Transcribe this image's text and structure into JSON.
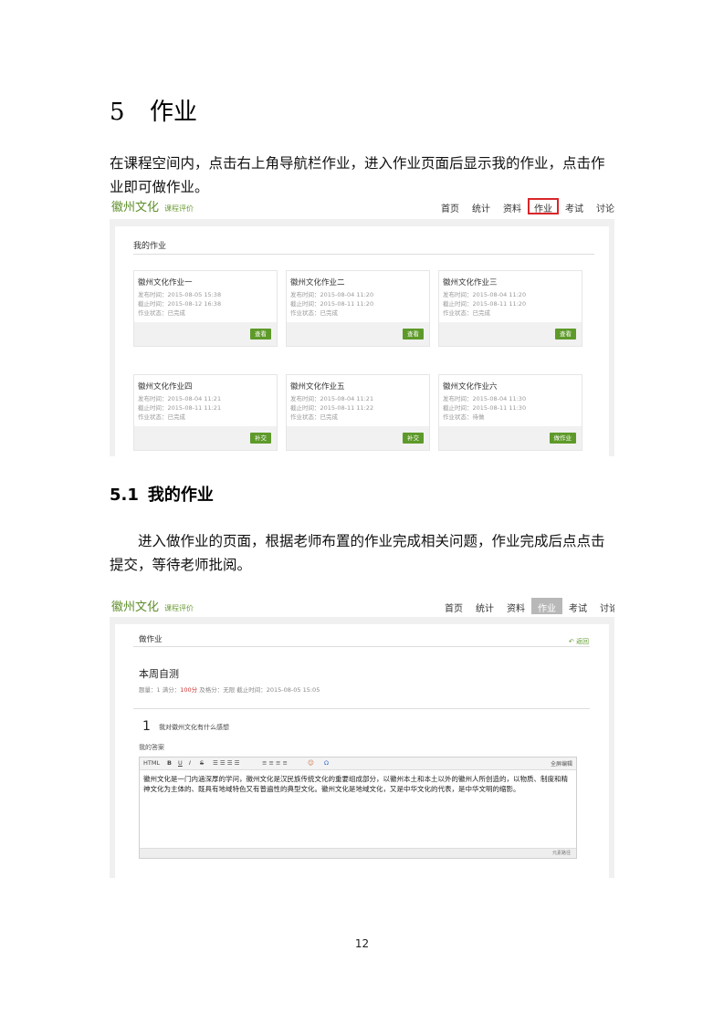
{
  "heading": {
    "num": "5",
    "title": "作业"
  },
  "intro": "在课程空间内，点击右上角导航栏作业，进入作业页面后显示我的作业，点击作业即可做作业。",
  "shot1": {
    "brand": "徽州文化",
    "brand_sub": "课程评价",
    "nav": [
      "首页",
      "统计",
      "资料",
      "作业",
      "考试",
      "讨论"
    ],
    "section_title": "我的作业",
    "cards": [
      {
        "title": "徽州文化作业一",
        "lines": [
          "发布时间：2015-08-05 15:38",
          "截止时间：2015-08-12 16:38",
          "作业状态：已完成"
        ],
        "button": "查看"
      },
      {
        "title": "徽州文化作业二",
        "lines": [
          "发布时间：2015-08-04 11:20",
          "截止时间：2015-08-11 11:20",
          "作业状态：已完成"
        ],
        "button": "查看"
      },
      {
        "title": "徽州文化作业三",
        "lines": [
          "发布时间：2015-08-04 11:20",
          "截止时间：2015-08-11 11:20",
          "作业状态：已完成"
        ],
        "button": "查看"
      },
      {
        "title": "徽州文化作业四",
        "lines": [
          "发布时间：2015-08-04 11:21",
          "截止时间：2015-08-11 11:21",
          "作业状态：已完成"
        ],
        "button": "补交"
      },
      {
        "title": "徽州文化作业五",
        "lines": [
          "发布时间：2015-08-04 11:21",
          "截止时间：2015-08-11 11:22",
          "作业状态：已完成"
        ],
        "button": "补交"
      },
      {
        "title": "徽州文化作业六",
        "lines": [
          "发布时间：2015-08-04 11:30",
          "截止时间：2015-08-11 11:30",
          "作业状态：待做"
        ],
        "button": "做作业"
      }
    ]
  },
  "section": {
    "num": "5.1",
    "title": "我的作业"
  },
  "body": "进入做作业的页面，根据老师布置的作业完成相关问题，作业完成后点点击提交，等待老师批阅。",
  "shot2": {
    "brand": "徽州文化",
    "brand_sub": "课程评价",
    "nav": [
      "首页",
      "统计",
      "资料",
      "作业",
      "考试",
      "讨论"
    ],
    "panel_title": "做作业",
    "back": "返回",
    "quiz_title": "本周自测",
    "meta_pre": "题量：1 满分：",
    "meta_red": "100分",
    "meta_post": " 及格分：无限 截止时间：2015-08-05 15:05",
    "q_no": "1",
    "q_text": "我对徽州文化有什么感想",
    "answer_label": "我的答案",
    "toolbar_items": [
      "HTML",
      "B",
      "U",
      "I",
      "S",
      "Ω"
    ],
    "fullscreen": "全屏编辑",
    "answer": "徽州文化是一门内涵深厚的学问，徽州文化是汉民族传统文化的重要组成部分，以徽州本土和本土以外的徽州人所创造的，以物质、制度和精神文化为主体的、既具有地域特色又有普遍性的典型文化。徽州文化是地域文化，又是中华文化的代表，是中华文明的缩影。",
    "footer_note": "元素路径"
  },
  "page_number": "12"
}
